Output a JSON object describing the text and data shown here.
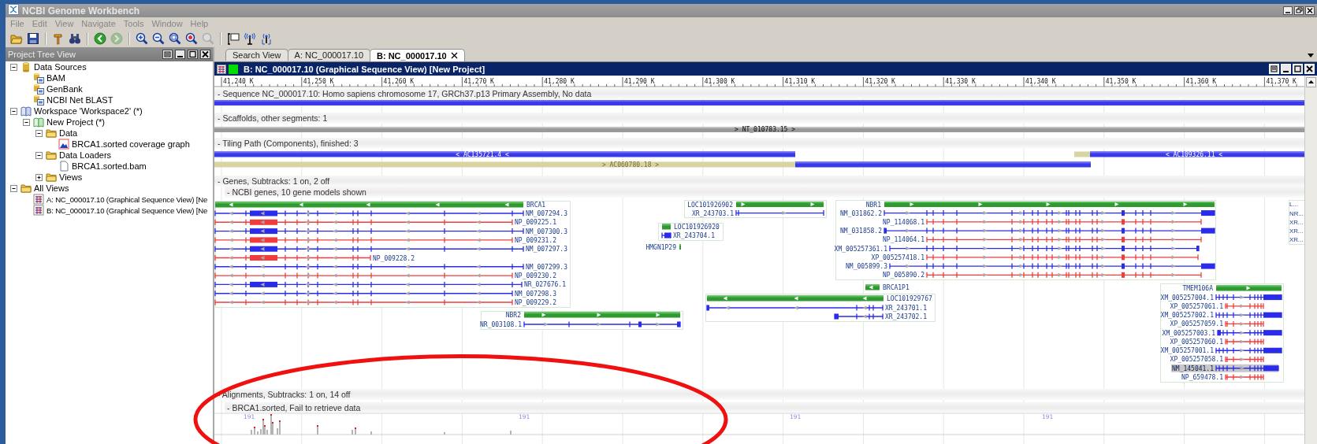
{
  "window": {
    "title": "NCBI Genome Workbench"
  },
  "menu": [
    "File",
    "Edit",
    "View",
    "Navigate",
    "Tools",
    "Window",
    "Help"
  ],
  "toolbar": [
    [
      {
        "kind": "open",
        "disabled": false
      },
      {
        "kind": "save",
        "disabled": false
      }
    ],
    [
      {
        "kind": "build",
        "disabled": false
      },
      {
        "kind": "find",
        "disabled": false
      }
    ],
    [
      {
        "kind": "back",
        "disabled": false
      },
      {
        "kind": "forward",
        "disabled": true
      }
    ],
    [
      {
        "kind": "zoom_in",
        "disabled": false
      },
      {
        "kind": "zoom_out",
        "disabled": false
      },
      {
        "kind": "zoom_fit",
        "disabled": false
      },
      {
        "kind": "zoom_text",
        "disabled": false
      },
      {
        "kind": "zoom_selection",
        "disabled": true
      }
    ],
    [
      {
        "kind": "layout",
        "disabled": false
      },
      {
        "kind": "broadcast",
        "disabled": false
      },
      {
        "kind": "broadcast_options",
        "disabled": false
      }
    ]
  ],
  "project_tree": {
    "title": "Project Tree View",
    "items": [
      {
        "label": "Data Sources",
        "kind": "database",
        "expanded": true,
        "children": [
          {
            "label": "BAM",
            "kind": "source"
          },
          {
            "label": "GenBank",
            "kind": "source"
          },
          {
            "label": "NCBI Net BLAST",
            "kind": "source"
          }
        ]
      },
      {
        "label": "Workspace 'Workspace2' (*)",
        "kind": "workspace",
        "expanded": true,
        "children": [
          {
            "label": "New Project (*)",
            "kind": "project",
            "expanded": true,
            "children": [
              {
                "label": "Data",
                "kind": "folder",
                "expanded": true,
                "children": [
                  {
                    "label": "BRCA1.sorted coverage graph",
                    "kind": "graph"
                  }
                ]
              },
              {
                "label": "Data Loaders",
                "kind": "folder",
                "expanded": true,
                "children": [
                  {
                    "label": "BRCA1.sorted.bam",
                    "kind": "file"
                  }
                ]
              },
              {
                "label": "Views",
                "kind": "folder",
                "expanded": false
              }
            ]
          }
        ]
      },
      {
        "label": "All Views",
        "kind": "folder",
        "expanded": true,
        "children": [
          {
            "label": "A: NC_000017.10 (Graphical Sequence View) [Ne",
            "kind": "view"
          },
          {
            "label": "B: NC_000017.10 (Graphical Sequence View) [Ne",
            "kind": "view"
          }
        ]
      }
    ]
  },
  "tabs": [
    {
      "label": "Search View",
      "selected": false
    },
    {
      "label": "A: NC_000017.10",
      "selected": false
    },
    {
      "label": "B: NC_000017.10",
      "selected": true
    }
  ],
  "view": {
    "title": "B: NC_000017.10 (Graphical Sequence View) [New Project]",
    "ruler": [
      "41,240 K",
      "41,250 K",
      "41,260 K",
      "41,270 K",
      "41,280 K",
      "41,290 K",
      "41,300 K",
      "41,310 K",
      "41,320 K",
      "41,330 K",
      "41,340 K",
      "41,350 K",
      "41,360 K",
      "41,370 K"
    ],
    "tracks": [
      {
        "kind": "sequence",
        "title": "- Sequence NC_000017.10: Homo sapiens chromosome 17, GRCh37.p13 Primary Assembly, No data"
      },
      {
        "kind": "scaffolds",
        "title": "- Scaffolds, other segments: 1",
        "features": [
          {
            "label": "> NT_010783.15 >"
          }
        ]
      },
      {
        "kind": "tiling",
        "title": "- Tiling Path (Components), finished: 3",
        "features": [
          {
            "label": "< AC135721.4 <"
          },
          {
            "label": "> AC060780.18 >"
          },
          {
            "label": "< AC109326.11 <"
          }
        ]
      },
      {
        "kind": "genes",
        "title": "- Genes, Subtracks: 1 on, 2 off",
        "subtitle": "- NCBI genes, 10 gene models shown",
        "genes": [
          {
            "label": "BRCA1",
            "transcripts": [
              {
                "label": "NM_007294.3",
                "kind": "rna",
                "selected": false
              },
              {
                "label": "NP_009225.1",
                "kind": "protein",
                "selected": false
              },
              {
                "label": "NM_007300.3",
                "kind": "rna",
                "selected": false
              },
              {
                "label": "NP_009231.2",
                "kind": "protein",
                "selected": false
              },
              {
                "label": "NM_007297.3",
                "kind": "rna",
                "selected": false
              },
              {
                "label": "NP_009228.2",
                "kind": "protein",
                "selected": false
              },
              {
                "label": "NM_007299.3",
                "kind": "rna",
                "selected": false
              },
              {
                "label": "NP_009230.2",
                "kind": "protein",
                "selected": false
              },
              {
                "label": "NR_027676.1",
                "kind": "rna",
                "selected": false
              },
              {
                "label": "NM_007298.3",
                "kind": "rna",
                "selected": false
              },
              {
                "label": "NP_009229.2",
                "kind": "protein",
                "selected": false
              }
            ]
          },
          {
            "label": "NBR2",
            "transcripts": [
              {
                "label": "NR_003108.1",
                "kind": "rna",
                "selected": false
              }
            ]
          },
          {
            "label": "LOC101926902",
            "transcripts": [
              {
                "label": "XR_243703.1",
                "kind": "rna",
                "selected": false
              }
            ]
          },
          {
            "label": "LOC101926920",
            "transcripts": [
              {
                "label": "XR_243704.1",
                "kind": "rna",
                "selected": false
              }
            ]
          },
          {
            "label": "HMGN1P29"
          },
          {
            "label": "NBR1",
            "transcripts": [
              {
                "label": "NM_031862.2",
                "kind": "rna",
                "selected": false
              },
              {
                "label": "NP_114068.1",
                "kind": "protein",
                "selected": false
              },
              {
                "label": "NM_031858.2",
                "kind": "rna",
                "selected": false
              },
              {
                "label": "NP_114064.1",
                "kind": "protein",
                "selected": false
              },
              {
                "label": "XM_005257361.1",
                "kind": "rna",
                "selected": false
              },
              {
                "label": "XP_005257418.1",
                "kind": "protein",
                "selected": false
              },
              {
                "label": "NM_005899.3",
                "kind": "rna",
                "selected": false
              },
              {
                "label": "NP_005890.2",
                "kind": "protein",
                "selected": false
              }
            ]
          },
          {
            "label": "BRCA1P1"
          },
          {
            "label": "LOC101929767",
            "transcripts": [
              {
                "label": "XR_243701.1",
                "kind": "rna",
                "selected": false
              },
              {
                "label": "XR_243702.1",
                "kind": "rna",
                "selected": false
              }
            ]
          },
          {
            "label": "TMEM106A",
            "transcripts": [
              {
                "label": "XM_005257004.1",
                "kind": "rna",
                "selected": false
              },
              {
                "label": "XP_005257061.1",
                "kind": "protein",
                "selected": false
              },
              {
                "label": "XM_005257002.1",
                "kind": "rna",
                "selected": false
              },
              {
                "label": "XP_005257059.1",
                "kind": "protein",
                "selected": false
              },
              {
                "label": "XM_005257003.1",
                "kind": "rna",
                "selected": false
              },
              {
                "label": "XP_005257060.1",
                "kind": "protein",
                "selected": false
              },
              {
                "label": "XM_005257001.1",
                "kind": "rna",
                "selected": false
              },
              {
                "label": "XP_005257058.1",
                "kind": "protein",
                "selected": false
              },
              {
                "label": "NM_145041.1",
                "kind": "rna",
                "selected": true
              },
              {
                "label": "NP_659478.1",
                "kind": "protein",
                "selected": false
              }
            ]
          },
          {
            "label": "L...",
            "transcripts": [
              {
                "label": "NR...",
                "selected": false
              },
              {
                "label": "XR...",
                "selected": false
              },
              {
                "label": "XR...",
                "selected": false
              },
              {
                "label": "XR...",
                "selected": false
              }
            ]
          }
        ]
      },
      {
        "kind": "alignments",
        "title": "- Alignments, Subtracks: 1 on, 14 off",
        "subtitle": "- BRCA1.sorted, Fail to retrieve data",
        "graph_labels": [
          "191",
          "191",
          "191",
          "191"
        ]
      }
    ]
  },
  "annotations": [
    {
      "kind": "ellipse"
    }
  ]
}
